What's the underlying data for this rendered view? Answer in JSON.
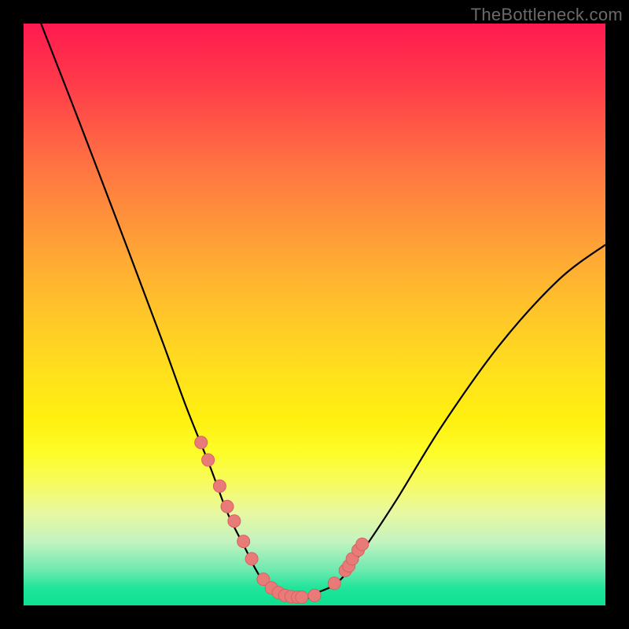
{
  "watermark": "TheBottleneck.com",
  "colors": {
    "frame": "#000000",
    "curve": "#000000",
    "dot_fill": "#e87a78",
    "dot_stroke": "#d86260"
  },
  "chart_data": {
    "type": "line",
    "title": "",
    "xlabel": "",
    "ylabel": "",
    "xlim": [
      0,
      100
    ],
    "ylim": [
      0,
      100
    ],
    "grid": false,
    "legend": false,
    "note": "Values are estimated relative percentages; x spans left→right of plot area, y spans bottom(0)→top(100).",
    "series": [
      {
        "name": "bottleneck-curve",
        "x": [
          3,
          10,
          18,
          24,
          28,
          32,
          35,
          38,
          40,
          42,
          44,
          48,
          50,
          54,
          58,
          64,
          72,
          82,
          92,
          100
        ],
        "y": [
          100,
          82,
          61,
          45,
          34,
          24,
          16,
          10,
          6,
          3,
          2,
          1,
          2,
          4,
          9,
          18,
          31,
          45,
          56,
          62
        ]
      }
    ],
    "dots": {
      "name": "highlighted-points",
      "x": [
        30.5,
        31.7,
        33.7,
        35.0,
        36.2,
        37.8,
        39.2,
        41.2,
        42.6,
        43.8,
        44.9,
        46.0,
        47.1,
        47.8,
        50.0,
        53.4,
        55.3,
        55.9,
        56.5,
        57.5,
        58.2
      ],
      "y": [
        28.0,
        25.0,
        20.5,
        17.0,
        14.5,
        11.0,
        8.0,
        4.5,
        3.0,
        2.2,
        1.7,
        1.5,
        1.4,
        1.4,
        1.7,
        3.8,
        6.0,
        6.8,
        8.0,
        9.5,
        10.5
      ]
    }
  }
}
